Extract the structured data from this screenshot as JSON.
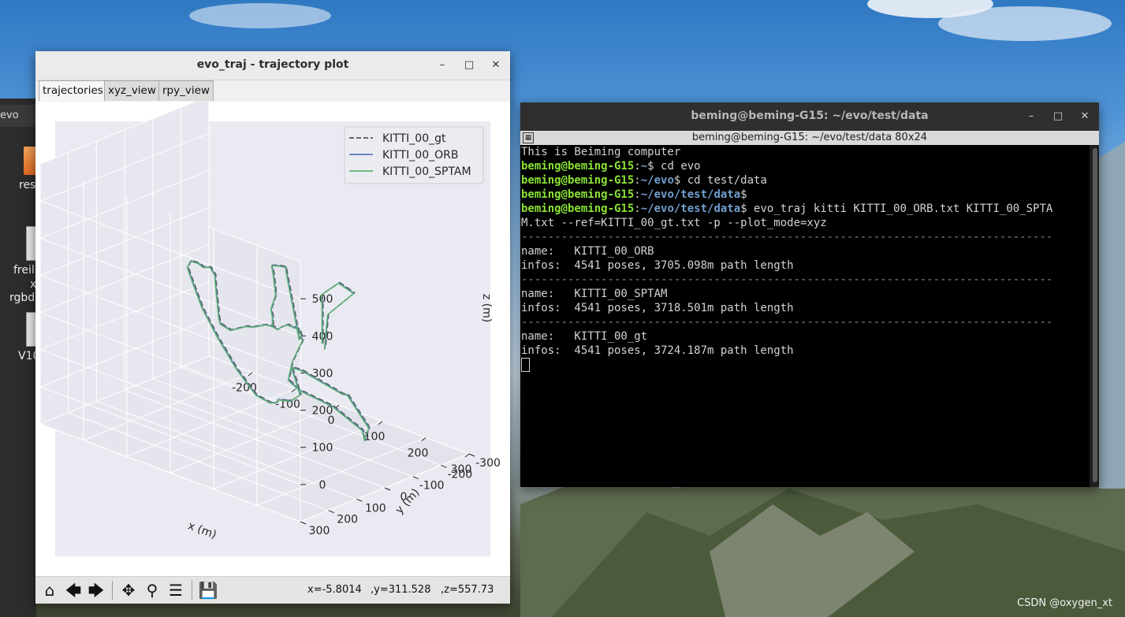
{
  "desktop": {
    "watermark": "CSDN @oxygen_xt",
    "filemgr_tab": "evo",
    "icons": [
      "res",
      "freil",
      "x",
      "rgbd",
      "V10"
    ]
  },
  "plot_window": {
    "title": "evo_traj - trajectory plot",
    "tabs": [
      "trajectories",
      "xyz_view",
      "rpy_view"
    ],
    "active_tab": "trajectories",
    "coords": {
      "x": "x=-5.8014",
      "y": ",y=311.528",
      "z": ",z=557.73"
    },
    "toolbar_icons": [
      "home-icon",
      "back-icon",
      "forward-icon",
      "pan-icon",
      "zoom-icon",
      "configure-icon",
      "save-icon"
    ]
  },
  "chart_data": {
    "type": "line",
    "projection": "3d",
    "xlabel": "x (m)",
    "ylabel": "y (m)",
    "zlabel": "z (m)",
    "x_ticks": [
      "-200",
      "-100",
      "0",
      "100",
      "200",
      "300"
    ],
    "y_ticks": [
      "-300",
      "-200",
      "-100",
      "0",
      "100",
      "200",
      "300"
    ],
    "z_ticks": [
      "0",
      "100",
      "200",
      "300",
      "400",
      "500"
    ],
    "series": [
      {
        "name": "KITTI_00_gt",
        "color": "#555555",
        "style": "dashed"
      },
      {
        "name": "KITTI_00_ORB",
        "color": "#5a78b6",
        "style": "solid"
      },
      {
        "name": "KITTI_00_SPTAM",
        "color": "#5cb46e",
        "style": "solid"
      }
    ],
    "legend_position": "top-right",
    "background": "#eaeaf2",
    "grid": true
  },
  "terminal_window": {
    "title": "beming@beming-G15: ~/evo/test/data",
    "subtitle": "beming@beming-G15: ~/evo/test/data 80x24",
    "lines": [
      {
        "text": "This is Beiming computer"
      },
      {
        "user": "beming@beming-G15",
        "path": "~",
        "cmd": "$ cd evo"
      },
      {
        "user": "beming@beming-G15",
        "path": "~/evo",
        "cmd": "$ cd test/data"
      },
      {
        "user": "beming@beming-G15",
        "path": "~/evo/test/data",
        "cmd": "$"
      },
      {
        "user": "beming@beming-G15",
        "path": "~/evo/test/data",
        "cmd": "$ evo_traj kitti KITTI_00_ORB.txt KITTI_00_SPTA"
      },
      {
        "text": "M.txt --ref=KITTI_00_gt.txt -p --plot_mode=xyz"
      },
      {
        "dash": true
      },
      {
        "text": "name:   KITTI_00_ORB"
      },
      {
        "text": "infos:  4541 poses, 3705.098m path length"
      },
      {
        "dash": true
      },
      {
        "text": "name:   KITTI_00_SPTAM"
      },
      {
        "text": "infos:  4541 poses, 3718.501m path length"
      },
      {
        "dash": true
      },
      {
        "text": "name:   KITTI_00_gt"
      },
      {
        "text": "infos:  4541 poses, 3724.187m path length"
      }
    ]
  }
}
